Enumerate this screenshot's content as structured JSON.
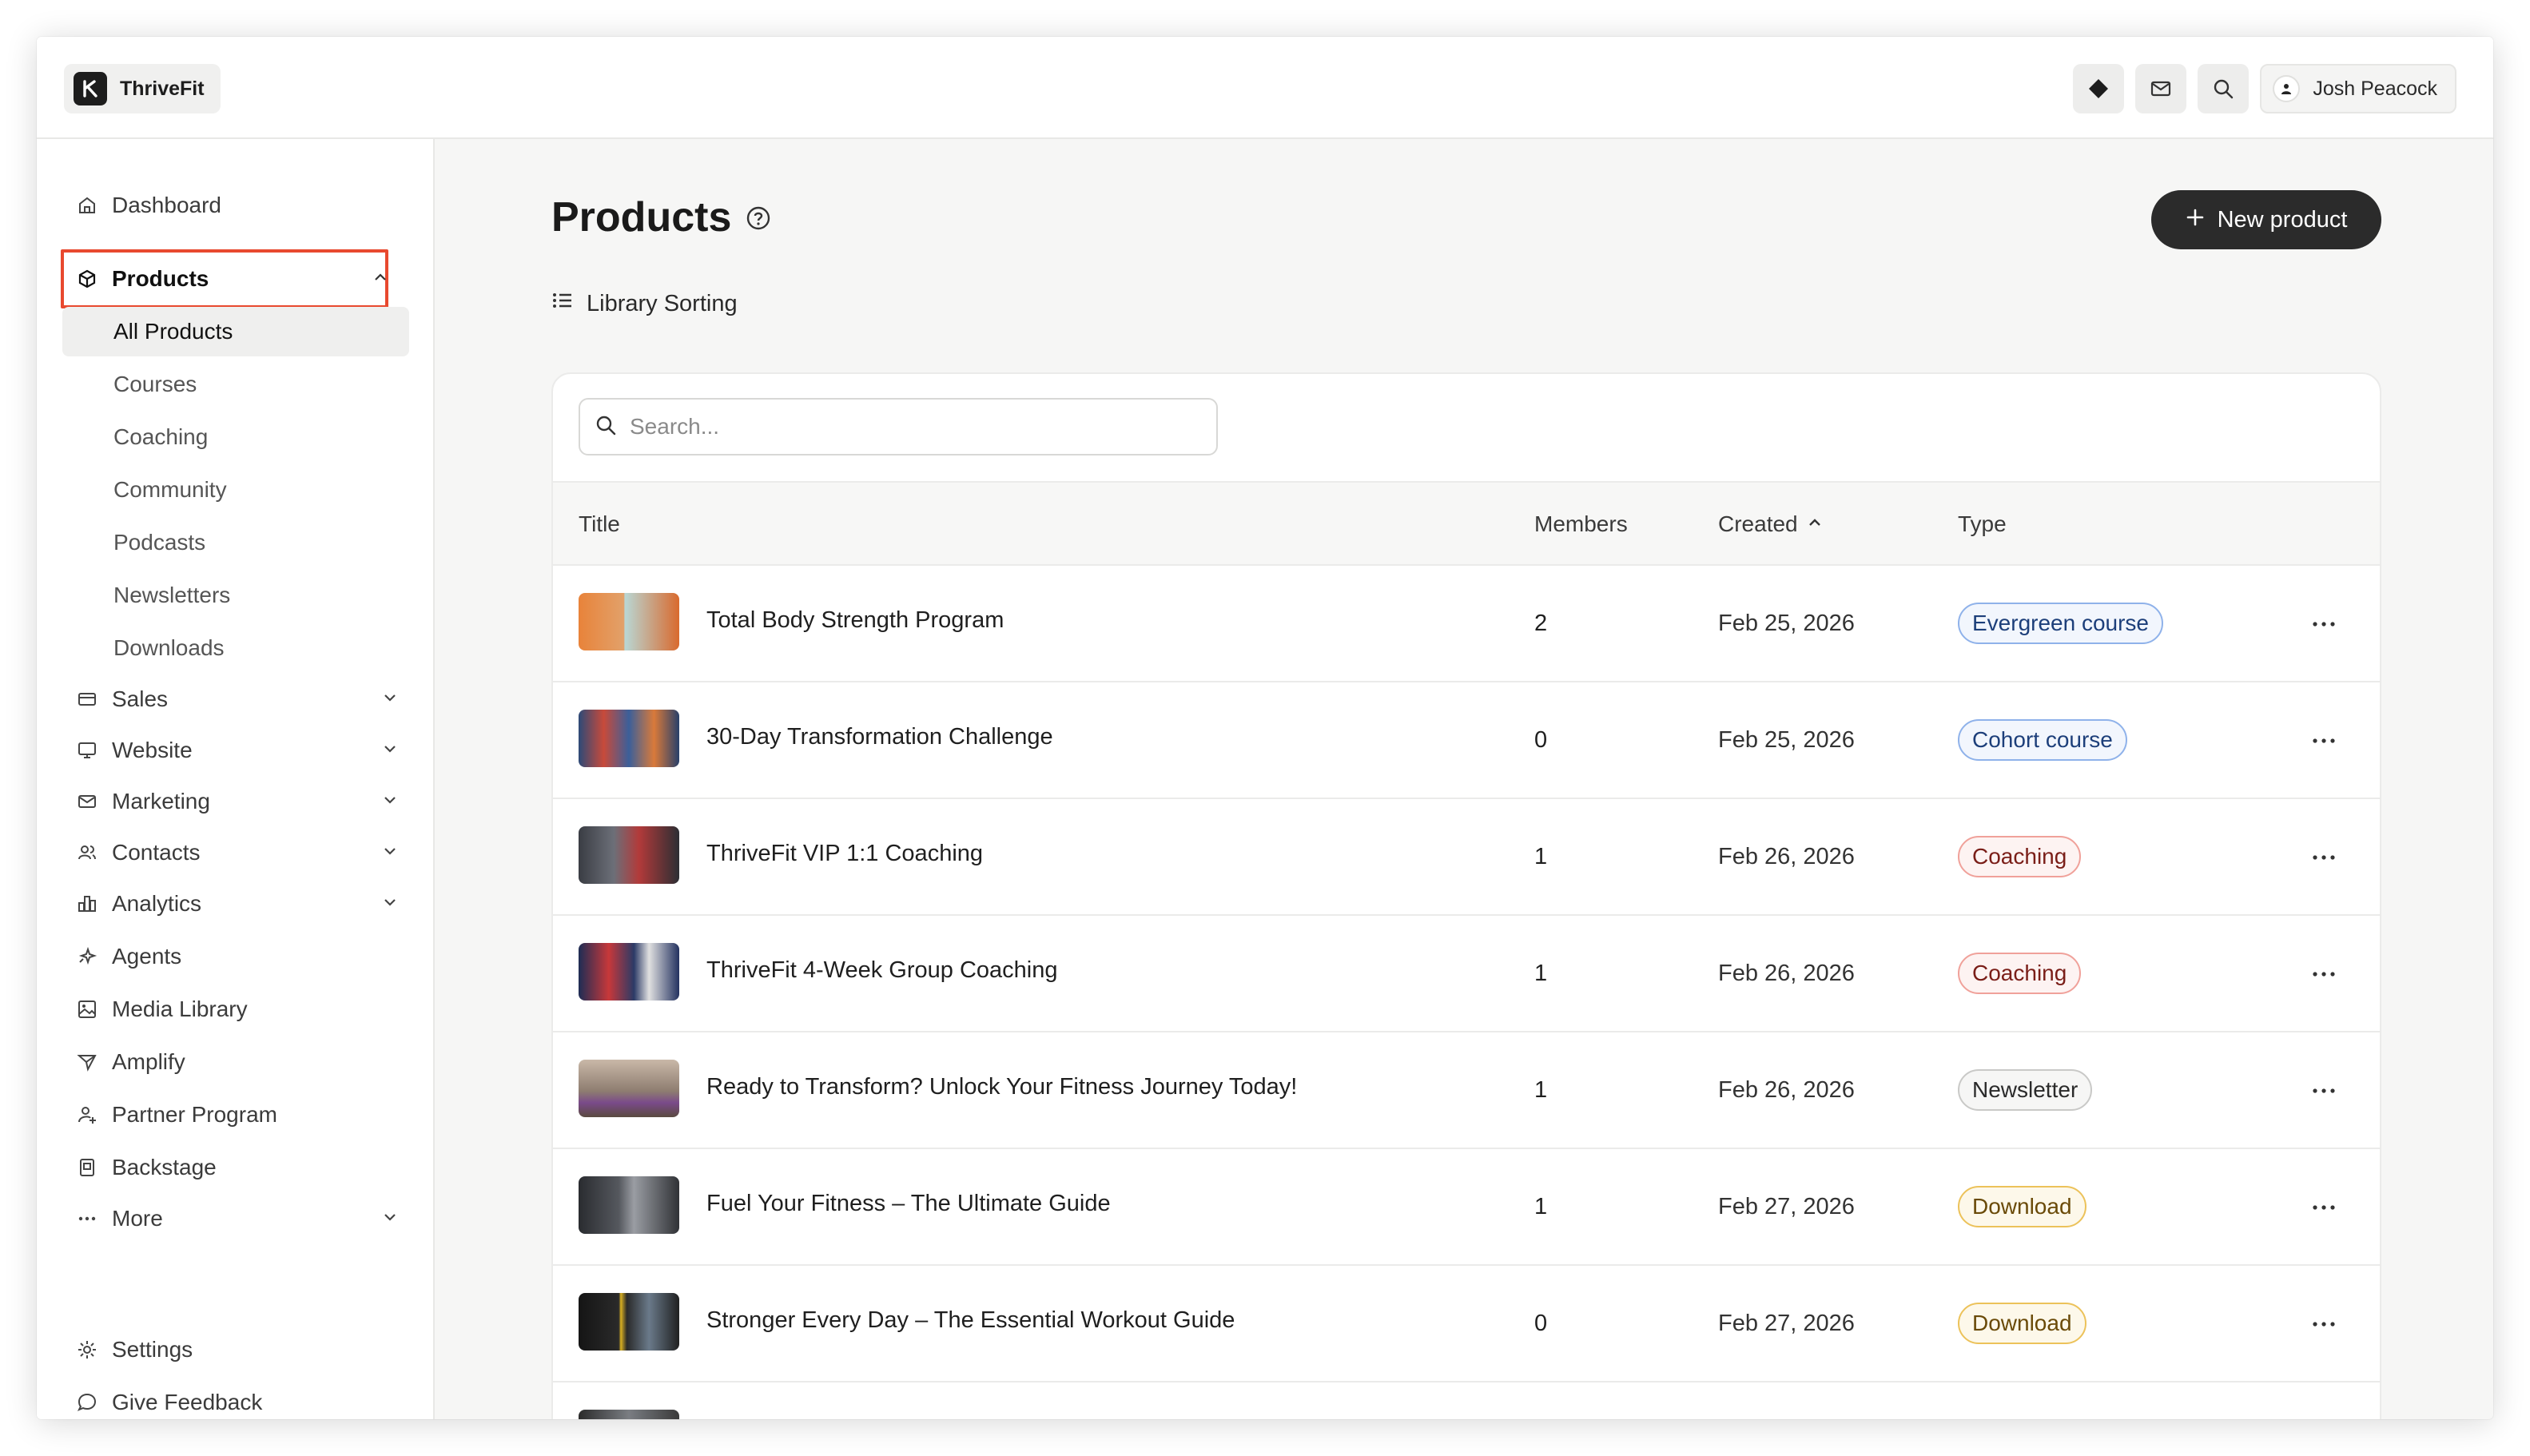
{
  "app": {
    "name": "ThriveFit"
  },
  "header": {
    "user_name": "Josh Peacock",
    "icons": [
      "diamond-icon",
      "mail-icon",
      "search-icon",
      "user-icon"
    ]
  },
  "sidebar": {
    "items": [
      {
        "label": "Dashboard",
        "icon": "home-icon"
      },
      {
        "label": "Products",
        "icon": "box-icon",
        "expanded": true
      },
      {
        "label": "Sales",
        "icon": "card-icon"
      },
      {
        "label": "Website",
        "icon": "monitor-icon"
      },
      {
        "label": "Marketing",
        "icon": "mail-icon"
      },
      {
        "label": "Contacts",
        "icon": "users-icon"
      },
      {
        "label": "Analytics",
        "icon": "bar-chart-icon"
      },
      {
        "label": "Agents",
        "icon": "sparkle-icon"
      },
      {
        "label": "Media Library",
        "icon": "image-icon"
      },
      {
        "label": "Amplify",
        "icon": "send-icon"
      },
      {
        "label": "Partner Program",
        "icon": "user-plus-icon"
      },
      {
        "label": "Backstage",
        "icon": "badge-icon"
      },
      {
        "label": "More",
        "icon": "dots-icon"
      }
    ],
    "products_sub": [
      "All Products",
      "Courses",
      "Coaching",
      "Community",
      "Podcasts",
      "Newsletters",
      "Downloads"
    ],
    "footer": [
      {
        "label": "Settings",
        "icon": "gear-icon"
      },
      {
        "label": "Give Feedback",
        "icon": "chat-icon"
      }
    ]
  },
  "main": {
    "title": "Products",
    "new_button": "New product",
    "library_sorting": "Library Sorting",
    "search_placeholder": "Search...",
    "columns": {
      "title": "Title",
      "members": "Members",
      "created": "Created",
      "type": "Type"
    },
    "rows": [
      {
        "title": "Total Body Strength Program",
        "members": "2",
        "created": "Feb 25, 2026",
        "type": "Evergreen course",
        "badge_color": "#2f6fd6"
      },
      {
        "title": "30-Day Transformation Challenge",
        "members": "0",
        "created": "Feb 25, 2026",
        "type": "Cohort course",
        "badge_color": "#2f6fd6"
      },
      {
        "title": "ThriveFit VIP 1:1 Coaching",
        "members": "1",
        "created": "Feb 26, 2026",
        "type": "Coaching",
        "badge_color": "#d9463b"
      },
      {
        "title": "ThriveFit 4-Week Group Coaching",
        "members": "1",
        "created": "Feb 26, 2026",
        "type": "Coaching",
        "badge_color": "#d9463b"
      },
      {
        "title": "Ready to Transform? Unlock Your Fitness Journey Today!",
        "members": "1",
        "created": "Feb 26, 2026",
        "type": "Newsletter",
        "badge_color": "#8a8a8a"
      },
      {
        "title": "Fuel Your Fitness – The Ultimate Guide",
        "members": "1",
        "created": "Feb 27, 2026",
        "type": "Download",
        "badge_color": "#d9a514"
      },
      {
        "title": "Stronger Every Day – The Essential Workout Guide",
        "members": "0",
        "created": "Feb 27, 2026",
        "type": "Download",
        "badge_color": "#d9a514"
      }
    ]
  }
}
